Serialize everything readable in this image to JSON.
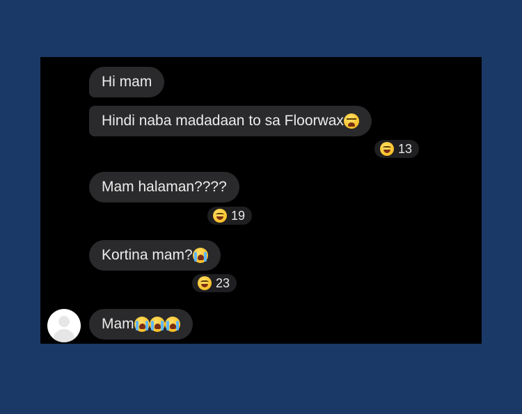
{
  "messages": [
    {
      "text": "Hi mam",
      "emoji": []
    },
    {
      "text": "Hindi naba madadaan to sa Floorwax",
      "emoji": [
        "tired-face"
      ]
    },
    {
      "text": "Mam halaman????",
      "emoji": []
    },
    {
      "text": "Kortina mam?",
      "emoji": [
        "loudly-crying-face"
      ]
    },
    {
      "text": "Mam",
      "emoji": [
        "loudly-crying-face",
        "loudly-crying-face",
        "loudly-crying-face"
      ]
    }
  ],
  "reactions": [
    {
      "emoji": "laughing-face",
      "count": "13"
    },
    {
      "emoji": "laughing-face",
      "count": "19"
    },
    {
      "emoji": "laughing-face",
      "count": "23"
    }
  ],
  "colors": {
    "background": "#1b3966",
    "chat_background": "#000000",
    "bubble": "#2a2a2c",
    "text": "#ececec"
  }
}
